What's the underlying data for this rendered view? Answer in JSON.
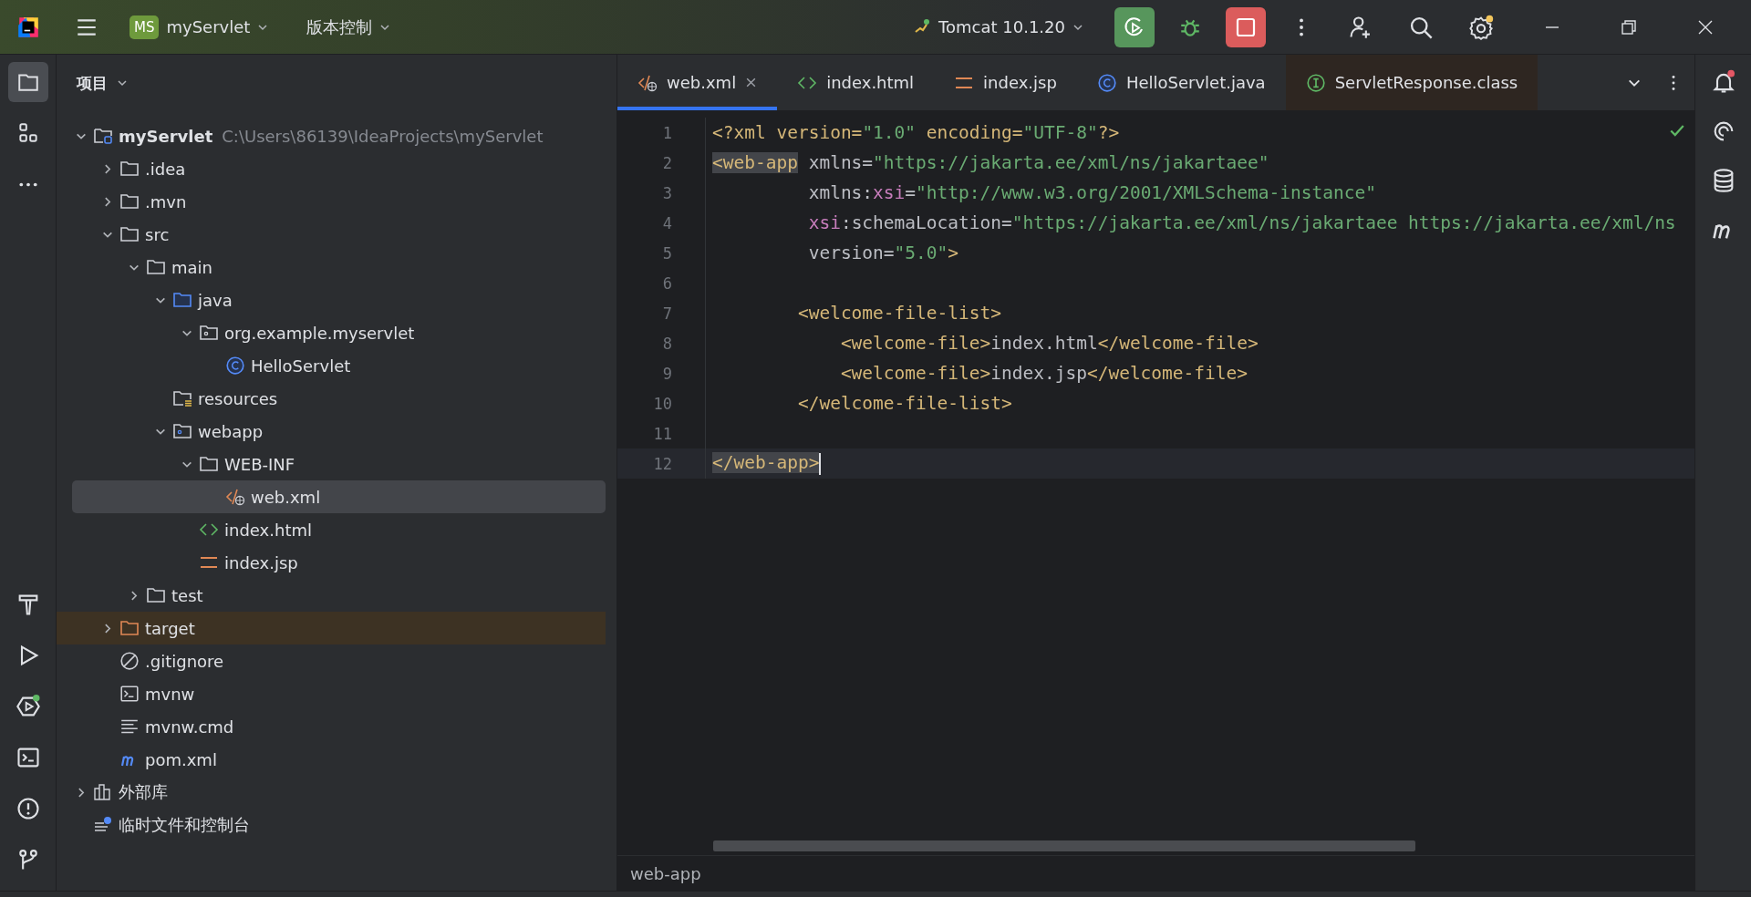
{
  "title_bar": {
    "project_badge": "MS",
    "project": "myServlet",
    "vcs": "版本控制",
    "run_config": "Tomcat 10.1.20"
  },
  "left_toolbar": [
    {
      "kind": "project",
      "selected": true
    },
    {
      "kind": "structure",
      "selected": false
    },
    {
      "kind": "more",
      "selected": false
    }
  ],
  "left_toolbar_bottom": [
    {
      "kind": "build",
      "selected": false
    },
    {
      "kind": "run",
      "selected": false
    },
    {
      "kind": "services",
      "selected": false
    },
    {
      "kind": "terminal",
      "selected": false
    },
    {
      "kind": "problems",
      "selected": false
    },
    {
      "kind": "git",
      "selected": false
    }
  ],
  "project_panel": {
    "title": "项目",
    "tree": [
      {
        "label": "myServlet",
        "path": "C:\\Users\\86139\\IdeaProjects\\myServlet",
        "kind": "module",
        "expanded": true,
        "selected": false,
        "children": [
          {
            "label": ".idea",
            "kind": "folder",
            "expanded": false,
            "selected": false
          },
          {
            "label": ".mvn",
            "kind": "folder",
            "expanded": false,
            "selected": false
          },
          {
            "label": "src",
            "kind": "folder",
            "expanded": true,
            "selected": false,
            "children": [
              {
                "label": "main",
                "kind": "folder",
                "expanded": true,
                "selected": false,
                "children": [
                  {
                    "label": "java",
                    "kind": "source-folder",
                    "expanded": true,
                    "selected": false,
                    "children": [
                      {
                        "label": "org.example.myservlet",
                        "kind": "package",
                        "expanded": true,
                        "selected": false,
                        "children": [
                          {
                            "label": "HelloServlet",
                            "kind": "class",
                            "selected": false
                          }
                        ]
                      }
                    ]
                  },
                  {
                    "label": "resources",
                    "kind": "resources",
                    "selected": false
                  },
                  {
                    "label": "webapp",
                    "kind": "web-folder",
                    "expanded": true,
                    "selected": false,
                    "children": [
                      {
                        "label": "WEB-INF",
                        "kind": "folder",
                        "expanded": true,
                        "selected": false,
                        "children": [
                          {
                            "label": "web.xml",
                            "kind": "xml",
                            "selected": true
                          }
                        ]
                      },
                      {
                        "label": "index.html",
                        "kind": "html",
                        "selected": false
                      },
                      {
                        "label": "index.jsp",
                        "kind": "jsp",
                        "selected": false
                      }
                    ]
                  }
                ]
              },
              {
                "label": "test",
                "kind": "folder",
                "expanded": false,
                "selected": false
              }
            ]
          },
          {
            "label": "target",
            "kind": "excluded-folder",
            "expanded": false,
            "selected": false
          },
          {
            "label": ".gitignore",
            "kind": "ignore",
            "selected": false
          },
          {
            "label": "mvnw",
            "kind": "shell",
            "selected": false
          },
          {
            "label": "mvnw.cmd",
            "kind": "text",
            "selected": false
          },
          {
            "label": "pom.xml",
            "kind": "maven",
            "selected": false
          }
        ]
      },
      {
        "label": "外部库",
        "kind": "library",
        "expanded": false,
        "selected": false
      },
      {
        "label": "临时文件和控制台",
        "kind": "scratch",
        "selected": false
      }
    ]
  },
  "tabs": [
    {
      "label": "web.xml",
      "kind": "xml",
      "selected": true
    },
    {
      "label": "index.html",
      "kind": "html",
      "selected": false
    },
    {
      "label": "index.jsp",
      "kind": "jsp",
      "selected": false
    },
    {
      "label": "HelloServlet.java",
      "kind": "class",
      "selected": false
    },
    {
      "label": "ServletResponse.class",
      "kind": "interface-readonly",
      "selected": false
    }
  ],
  "editor": {
    "lines": [
      {
        "number": "1",
        "current": false,
        "tokens": [
          {
            "text": "<?xml version=",
            "kind": "tag"
          },
          {
            "text": "\"1.0\"",
            "kind": "value"
          },
          {
            "text": " encoding=",
            "kind": "tag"
          },
          {
            "text": "\"UTF-8\"",
            "kind": "value"
          },
          {
            "text": "?>",
            "kind": "tag"
          }
        ]
      },
      {
        "number": "2",
        "current": false,
        "tokens": [
          {
            "text": "<web-app",
            "kind": "matched-tag"
          },
          {
            "text": " xmlns=",
            "kind": "attr"
          },
          {
            "text": "\"https://jakarta.ee/xml/ns/jakartaee\"",
            "kind": "value"
          }
        ]
      },
      {
        "number": "3",
        "current": false,
        "tokens": [
          {
            "text": "         xmlns:",
            "kind": "attr"
          },
          {
            "text": "xsi",
            "kind": "ns"
          },
          {
            "text": "=",
            "kind": "attr"
          },
          {
            "text": "\"http://www.w3.org/2001/XMLSchema-instance\"",
            "kind": "value"
          }
        ]
      },
      {
        "number": "4",
        "current": false,
        "tokens": [
          {
            "text": "         xsi",
            "kind": "ns"
          },
          {
            "text": ":schemaLocation=",
            "kind": "attr"
          },
          {
            "text": "\"https://jakarta.ee/xml/ns/jakartaee https://jakarta.ee/xml/ns",
            "kind": "value"
          }
        ]
      },
      {
        "number": "5",
        "current": false,
        "tokens": [
          {
            "text": "         version=",
            "kind": "attr"
          },
          {
            "text": "\"5.0\"",
            "kind": "value"
          },
          {
            "text": ">",
            "kind": "tag"
          }
        ]
      },
      {
        "number": "6",
        "current": false
      },
      {
        "number": "7",
        "current": false,
        "tokens": [
          {
            "text": "        <welcome-file-list>",
            "kind": "tag"
          }
        ]
      },
      {
        "number": "8",
        "current": false,
        "tokens": [
          {
            "text": "            <welcome-file>",
            "kind": "tag"
          },
          {
            "text": "index.html",
            "kind": "text"
          },
          {
            "text": "</welcome-file>",
            "kind": "tag"
          }
        ]
      },
      {
        "number": "9",
        "current": false,
        "tokens": [
          {
            "text": "            <welcome-file>",
            "kind": "tag"
          },
          {
            "text": "index.jsp",
            "kind": "text"
          },
          {
            "text": "</welcome-file>",
            "kind": "tag"
          }
        ]
      },
      {
        "number": "10",
        "current": false,
        "tokens": [
          {
            "text": "        </welcome-file-list>",
            "kind": "tag"
          }
        ]
      },
      {
        "number": "11",
        "current": false
      },
      {
        "number": "12",
        "current": true,
        "tokens": [
          {
            "text": "</web-app>",
            "kind": "matched-tag"
          }
        ]
      }
    ]
  },
  "right_toolbar": [
    {
      "kind": "notifications",
      "selected": false
    },
    {
      "kind": "ai-assistant",
      "selected": false
    },
    {
      "kind": "database",
      "selected": false
    },
    {
      "kind": "maven",
      "selected": false
    }
  ],
  "status_bar": {
    "breadcrumb": "web-app"
  }
}
